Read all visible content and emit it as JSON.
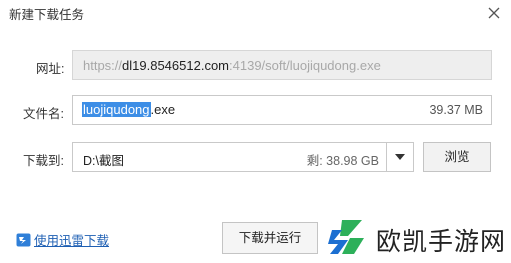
{
  "window": {
    "title": "新建下载任务"
  },
  "url_row": {
    "label": "网址:",
    "url_prefix": "https://",
    "url_host": "dl19.8546512.com",
    "url_rest": ":4139/soft/luojiqudong.exe"
  },
  "filename_row": {
    "label": "文件名:",
    "name_selected": "luojiqudong",
    "name_ext": ".exe",
    "size": "39.37 MB"
  },
  "save_row": {
    "label": "下载到:",
    "path": "D:\\截图",
    "free_space": "剩: 38.98 GB",
    "browse_label": "浏览"
  },
  "footer": {
    "xunlei_link": "使用迅雷下载",
    "download_run_label": "下载并运行"
  },
  "watermark": {
    "text": "欧凯手游网"
  },
  "colors": {
    "selection": "#3d8ee6",
    "link": "#1e5fb3",
    "logo_green": "#2db05a",
    "logo_blue": "#1c6fd1"
  }
}
